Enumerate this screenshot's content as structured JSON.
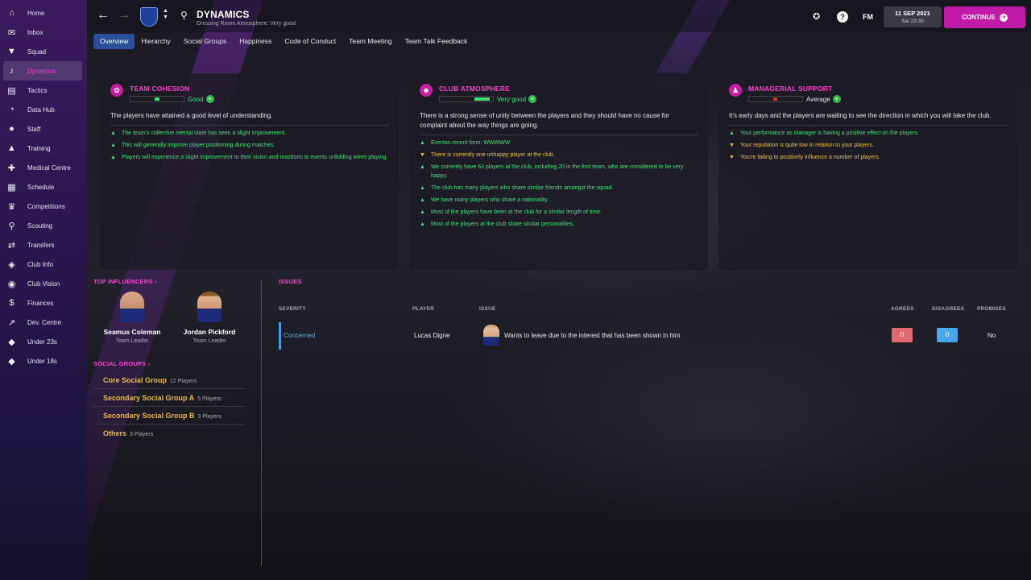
{
  "sidebar": {
    "items": [
      {
        "label": "Home",
        "icon": "home-icon",
        "glyph": "⌂"
      },
      {
        "label": "Inbox",
        "icon": "inbox-icon",
        "glyph": "✉"
      },
      {
        "label": "Squad",
        "icon": "shirt-icon",
        "glyph": "▼"
      },
      {
        "label": "Dynamics",
        "icon": "dynamics-icon",
        "glyph": "♪"
      },
      {
        "label": "Tactics",
        "icon": "tactics-icon",
        "glyph": "▤"
      },
      {
        "label": "Data Hub",
        "icon": "data-hub-icon",
        "glyph": "◔"
      },
      {
        "label": "Staff",
        "icon": "staff-icon",
        "glyph": "●"
      },
      {
        "label": "Training",
        "icon": "training-icon",
        "glyph": "▲"
      },
      {
        "label": "Medical Centre",
        "icon": "medical-icon",
        "glyph": "✚"
      },
      {
        "label": "Schedule",
        "icon": "calendar-icon",
        "glyph": "▦"
      },
      {
        "label": "Competitions",
        "icon": "trophy-icon",
        "glyph": "♛"
      },
      {
        "label": "Scouting",
        "icon": "scouting-icon",
        "glyph": "⚲"
      },
      {
        "label": "Transfers",
        "icon": "transfers-icon",
        "glyph": "⇄"
      },
      {
        "label": "Club Info",
        "icon": "club-info-icon",
        "glyph": "◈"
      },
      {
        "label": "Club Vision",
        "icon": "club-vision-icon",
        "glyph": "◉"
      },
      {
        "label": "Finances",
        "icon": "finances-icon",
        "glyph": "$"
      },
      {
        "label": "Dev. Centre",
        "icon": "dev-centre-icon",
        "glyph": "↗"
      },
      {
        "label": "Under 23s",
        "icon": "under-23s-icon",
        "glyph": "◆"
      },
      {
        "label": "Under 18s",
        "icon": "under-18s-icon",
        "glyph": "◆"
      }
    ]
  },
  "header": {
    "title": "DYNAMICS",
    "subtitle": "Dressing Room Atmosphere: Very good",
    "date": "11 SEP 2021",
    "time": "Sat 23:30",
    "continue_label": "CONTINUE",
    "help_label": "?",
    "fm_label": "FM"
  },
  "tabs": [
    "Overview",
    "Hierarchy",
    "Social Groups",
    "Happiness",
    "Code of Conduct",
    "Team Meeting",
    "Team Talk Feedback"
  ],
  "panels": {
    "cohesion": {
      "title": "TEAM COHESION",
      "rating": "Good",
      "rating_color": "#43e07a",
      "level": 0.55,
      "description": "The players have attained a good level of understanding.",
      "bullets": [
        {
          "type": "positive",
          "text": "The team's collective mental state has seen a slight improvement."
        },
        {
          "type": "positive",
          "text": "This will generally improve player positioning during matches."
        },
        {
          "type": "positive",
          "text": "Players will experience a slight improvement to their vision and reactions to events unfolding when playing."
        }
      ]
    },
    "atmosphere": {
      "title": "CLUB ATMOSPHERE",
      "rating": "Very good",
      "rating_color": "#43e07a",
      "level": 0.75,
      "description": "There is a strong sense of unity between the players and they should have no cause for complaint about the way things are going.",
      "bullets": [
        {
          "type": "positive",
          "text": "Everton recent form: WWWWW"
        },
        {
          "type": "negative",
          "text": "There is currently one unhappy player at the club."
        },
        {
          "type": "positive",
          "text": "We currently have 63 players at the club, including 20 in the first team, who are considered to be very happy."
        },
        {
          "type": "positive",
          "text": "The club has many players who share similar friends amongst the squad."
        },
        {
          "type": "positive",
          "text": "We have many players who share a nationality."
        },
        {
          "type": "positive",
          "text": "Most of the players have been at the club for a similar length of time."
        },
        {
          "type": "positive",
          "text": "Most of the players at the club share similar personalities."
        }
      ]
    },
    "support": {
      "title": "MANAGERIAL SUPPORT",
      "rating": "Average",
      "rating_color": "#e9e9f0",
      "level": 0.5,
      "description": "It's early days and the players are waiting to see the direction in which you will take the club.",
      "bullets": [
        {
          "type": "positive",
          "text": "Your performance as manager is having a positive effect on the players."
        },
        {
          "type": "negative",
          "text": "Your reputation is quite low in relation to your players."
        },
        {
          "type": "negative",
          "text": "You're failing to positively influence a number of players."
        }
      ]
    }
  },
  "influencers": {
    "title": "TOP INFLUENCERS",
    "people": [
      {
        "name": "Seamus Coleman",
        "role": "Team Leader"
      },
      {
        "name": "Jordan Pickford",
        "role": "Team Leader"
      }
    ]
  },
  "social_groups": {
    "title": "SOCIAL GROUPS",
    "groups": [
      {
        "name": "Core Social Group",
        "count": "12 Players"
      },
      {
        "name": "Secondary Social Group A",
        "count": "5 Players"
      },
      {
        "name": "Secondary Social Group B",
        "count": "3 Players"
      },
      {
        "name": "Others",
        "count": "3 Players"
      }
    ]
  },
  "issues": {
    "title": "ISSUES",
    "columns": {
      "severity": "SEVERITY",
      "player": "PLAYER",
      "issue": "ISSUE",
      "agrees": "AGREES",
      "disagrees": "DISAGREES",
      "promises": "PROMISES"
    },
    "rows": [
      {
        "severity": "Concerned",
        "player": "Lucas Digne",
        "issue": "Wants to leave due to the interest that has been shown in him",
        "agrees": "0",
        "disagrees": "0",
        "promises": "No"
      }
    ]
  },
  "colors": {
    "accent": "#ff3fd0",
    "continue": "#c21aa8",
    "tab_active": "#2b4f9c"
  }
}
